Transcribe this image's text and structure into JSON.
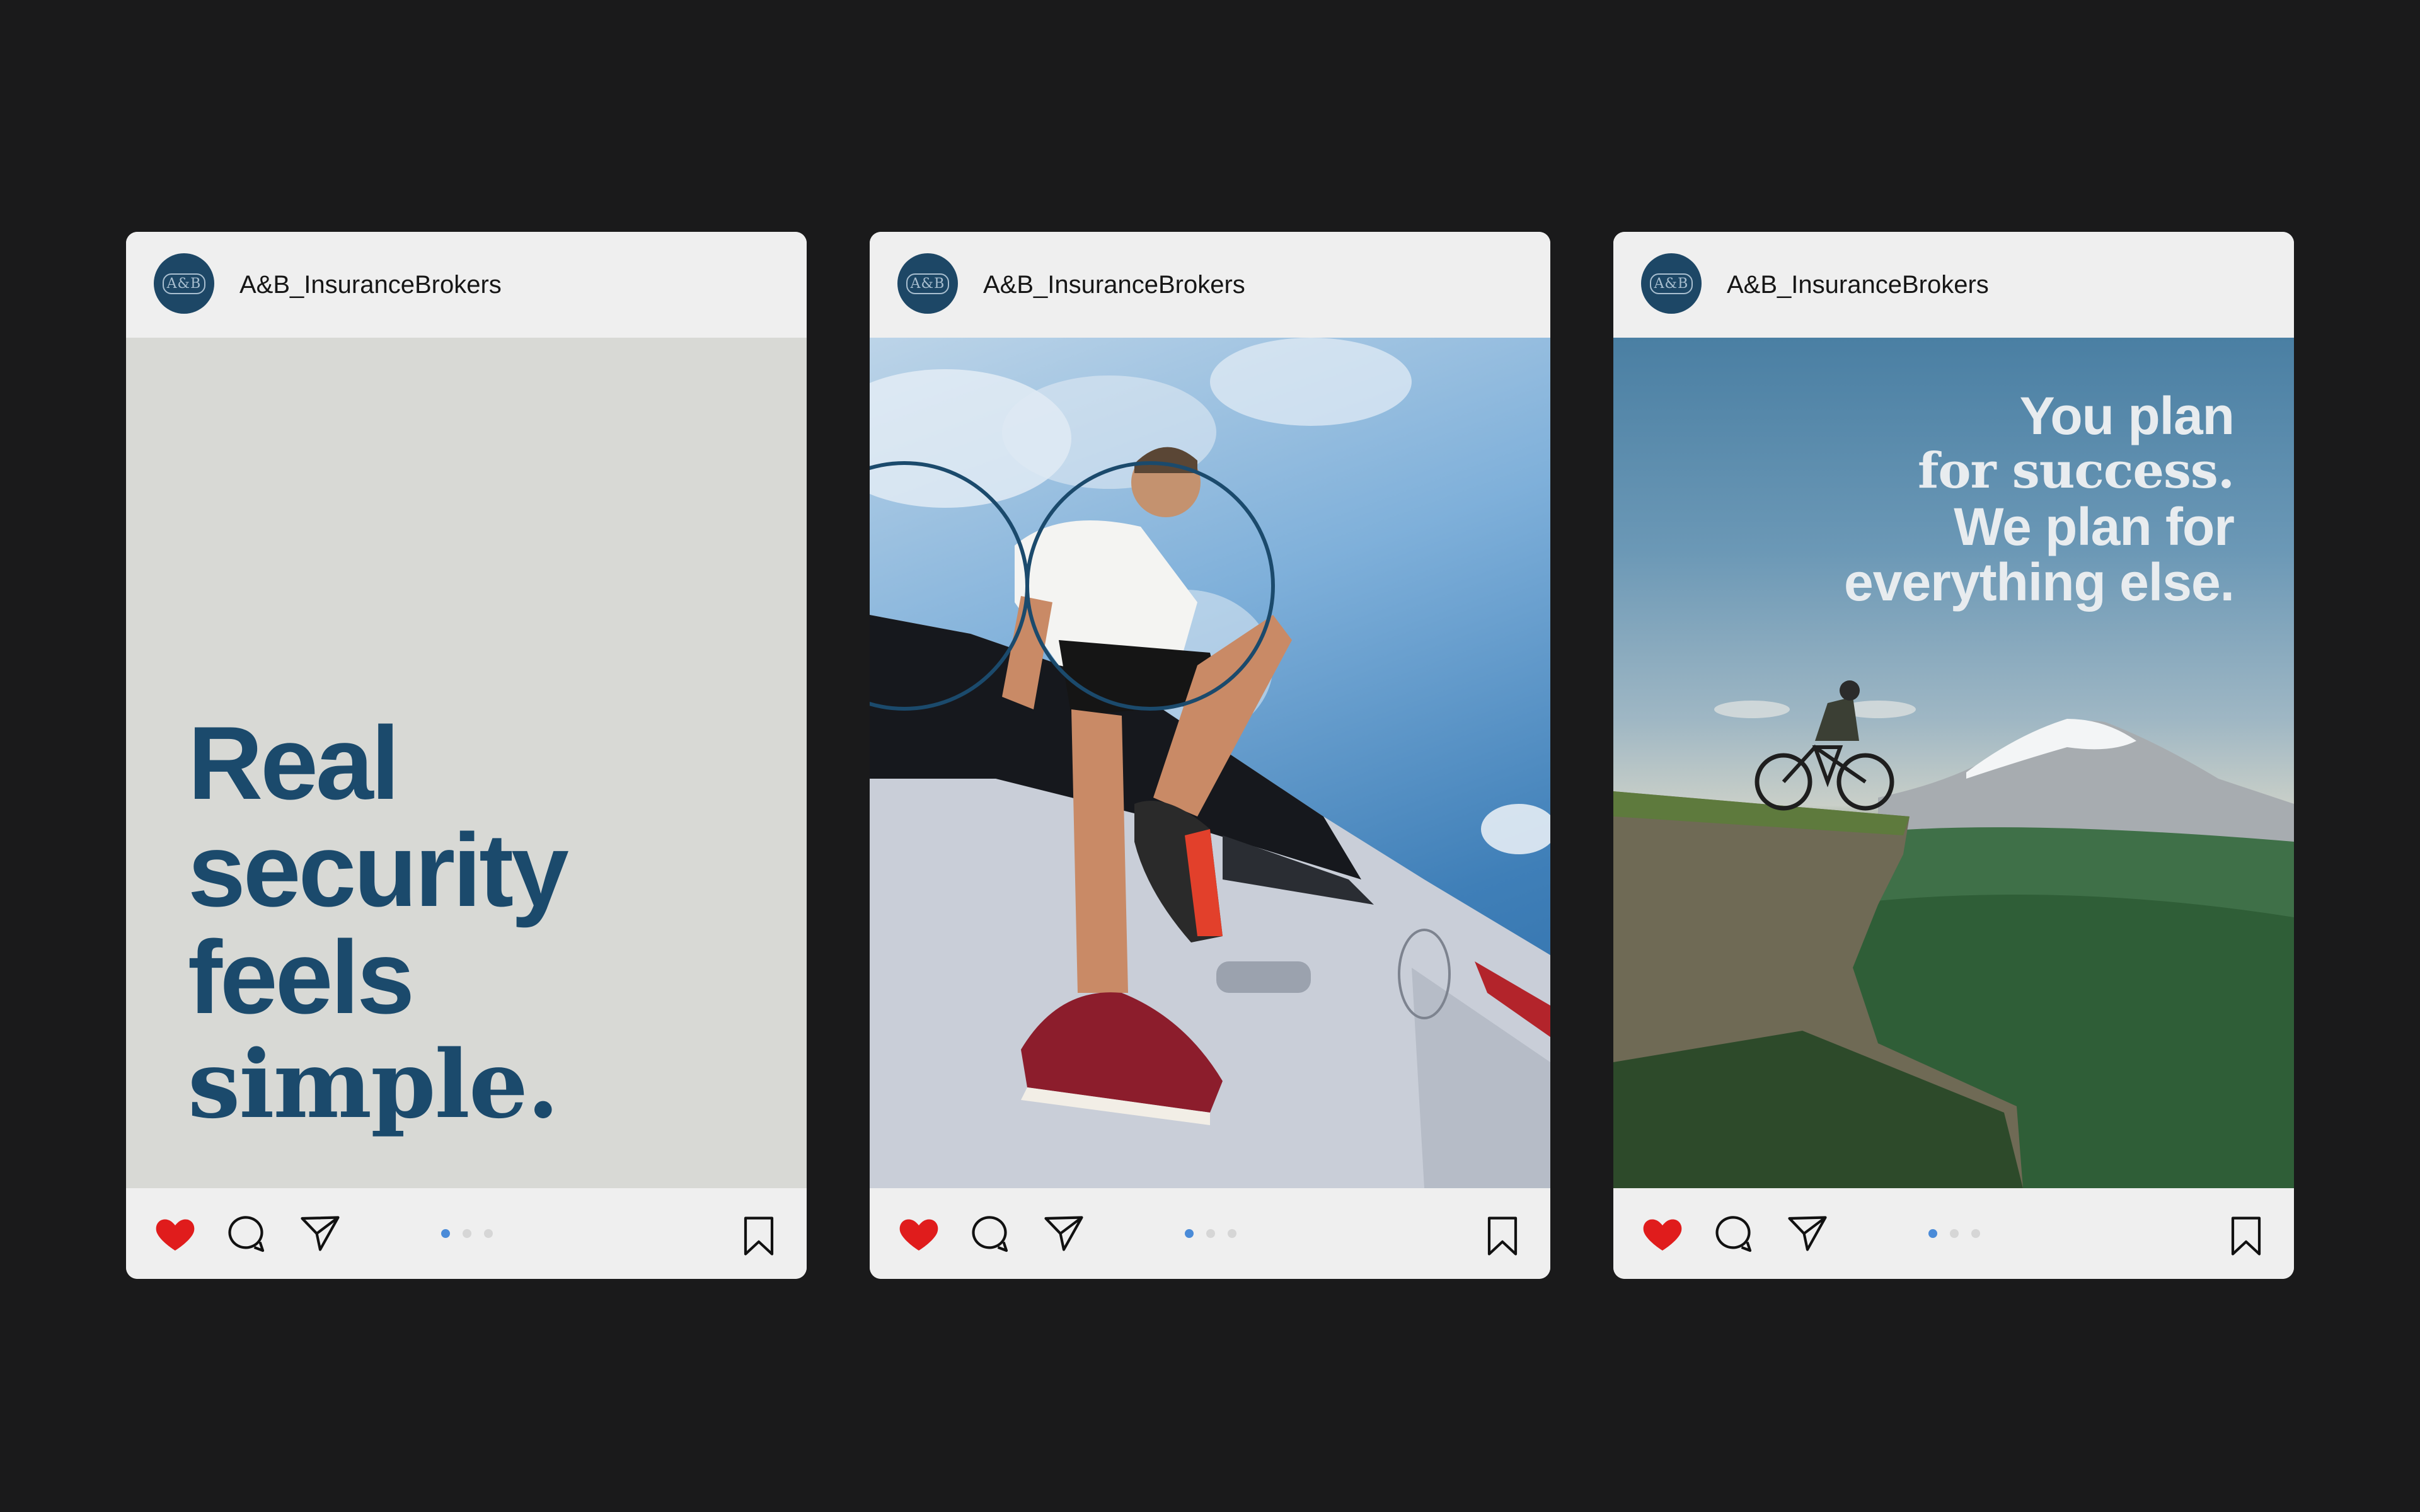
{
  "colors": {
    "background": "#1a1a1b",
    "card": "#efefef",
    "brand_navy": "#1b4a6c",
    "avatar": "#1d4766",
    "heart": "#e01c1c",
    "dot_active": "#4a8bd8",
    "dot_inactive": "#d6d6d6"
  },
  "posts": [
    {
      "username": "A&B_InsuranceBrokers",
      "avatar_text": "A&B",
      "headline": [
        "Real",
        "security",
        "feels",
        "simple."
      ],
      "carousel": {
        "count": 3,
        "active": 0
      },
      "icons": [
        "heart-icon",
        "comment-icon",
        "share-icon",
        "bookmark-icon"
      ]
    },
    {
      "username": "A&B_InsuranceBrokers",
      "avatar_text": "A&B",
      "image_subject": "man-sitting-on-car",
      "carousel": {
        "count": 3,
        "active": 0
      },
      "icons": [
        "heart-icon",
        "comment-icon",
        "share-icon",
        "bookmark-icon"
      ]
    },
    {
      "username": "A&B_InsuranceBrokers",
      "avatar_text": "A&B",
      "headline": [
        "You plan",
        "for success.",
        "We plan for",
        "everything else."
      ],
      "image_subject": "cyclist-on-cliff-mountain",
      "carousel": {
        "count": 3,
        "active": 0
      },
      "icons": [
        "heart-icon",
        "comment-icon",
        "share-icon",
        "bookmark-icon"
      ]
    }
  ]
}
